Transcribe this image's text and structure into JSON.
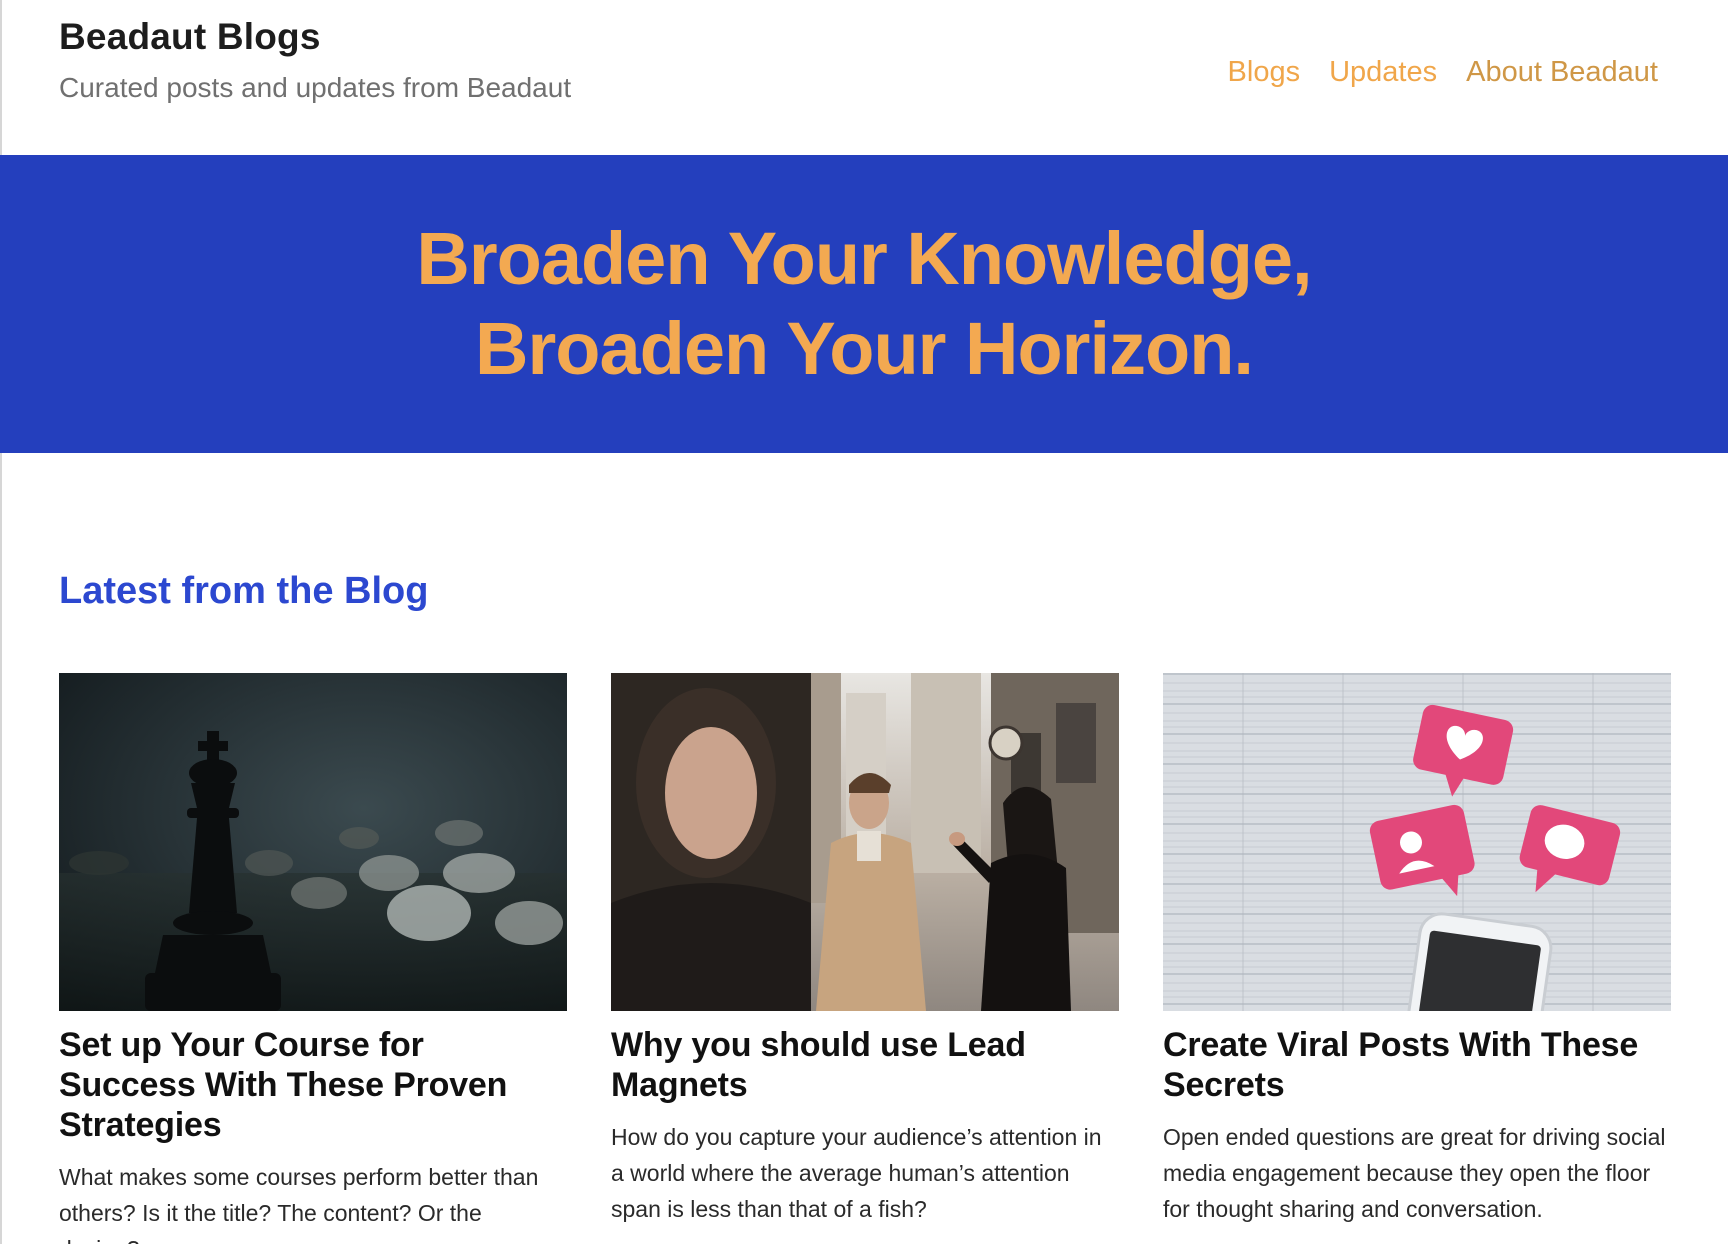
{
  "site": {
    "title": "Beadaut Blogs",
    "tagline": "Curated posts and updates from Beadaut"
  },
  "nav": {
    "items": [
      "Blogs",
      "Updates",
      "About Beadaut"
    ]
  },
  "hero": {
    "line1": "Broaden Your Knowledge,",
    "line2": "Broaden Your Horizon."
  },
  "latest": {
    "heading": "Latest from the Blog",
    "posts": [
      {
        "title": "Set up Your Course for Success With These Proven Strategies",
        "excerpt": "What makes some courses perform better than others? Is it the title? The content? Or the design?",
        "image_icon": "chess-king-photo"
      },
      {
        "title": "Why you should use Lead Magnets",
        "excerpt": "How do you capture your audience’s attention in a world where the average human’s attention span is less than that of a fish?",
        "image_icon": "street-people-photo"
      },
      {
        "title": "Create Viral Posts With These Secrets",
        "excerpt": "Open ended questions are great for driving social media engagement because they open the floor for thought sharing and conversation.",
        "image_icon": "social-reactions-phone-photo"
      }
    ]
  },
  "colors": {
    "hero_bg": "#243fbd",
    "hero_text": "#f3a951",
    "nav_link": "#f0a64a",
    "heading_blue": "#2c48d0"
  }
}
